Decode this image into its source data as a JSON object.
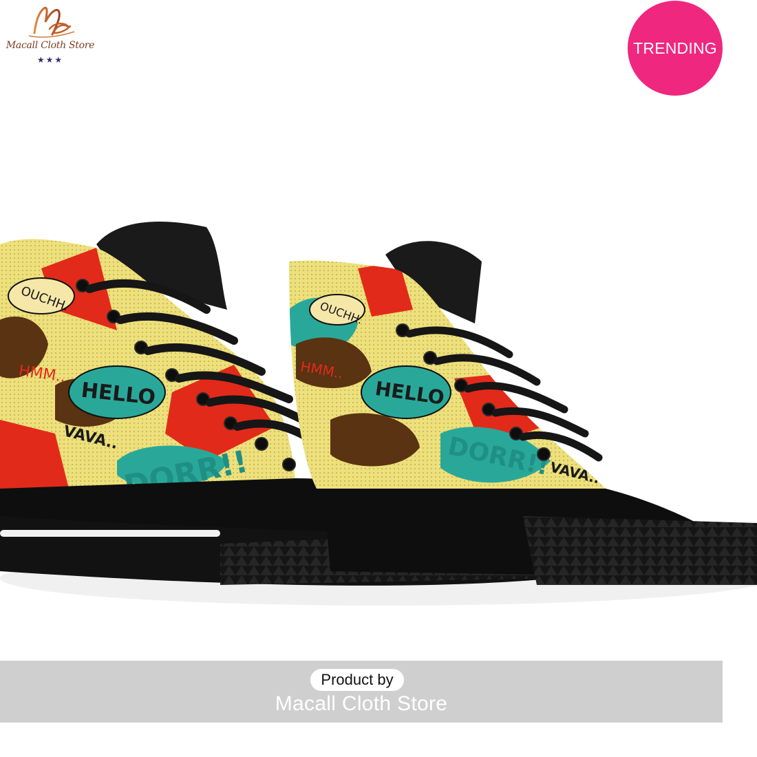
{
  "logo": {
    "name": "Macall Cloth Store",
    "stars": "★★★",
    "monogram": "mc"
  },
  "badge": {
    "label": "TRENDING",
    "color": "#f0277f"
  },
  "product": {
    "image": "high-top-sneakers-comic-pop-art",
    "print_words": [
      "HELLO",
      "HMM..",
      "OUCHH.",
      "VAVA..",
      "DORR!!"
    ],
    "colors": {
      "teal": "#29a89a",
      "red": "#e22a1a",
      "yellow": "#eee07a",
      "brown": "#5a3312",
      "black": "#111111"
    }
  },
  "footer": {
    "label": "Product by",
    "store": "Macall Cloth Store"
  }
}
